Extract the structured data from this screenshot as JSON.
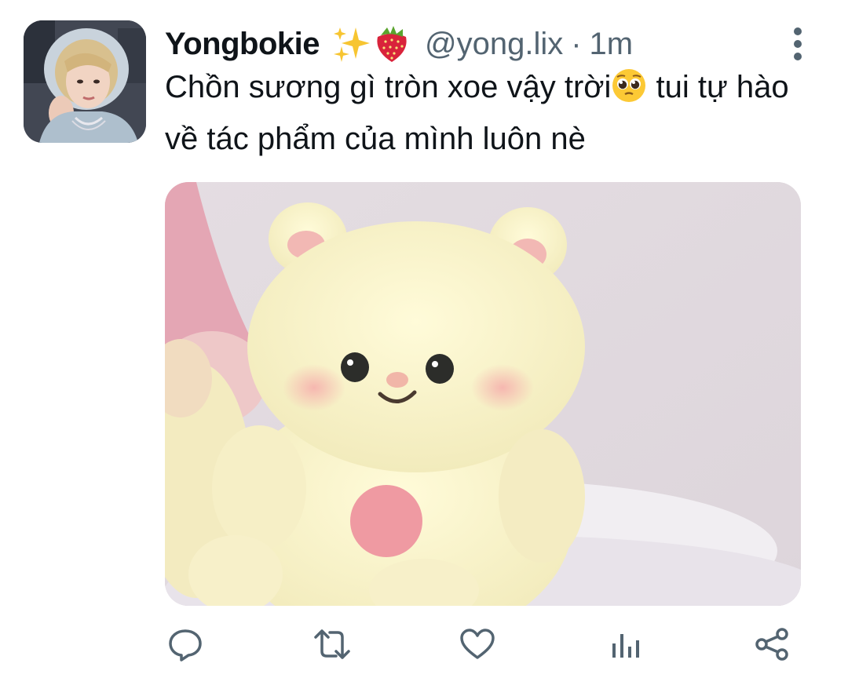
{
  "tweet": {
    "display_name": "Yongbokie",
    "handle": "@yong.lix",
    "separator": "·",
    "time": "1m",
    "text_part1": "Chồn sương gì tròn xoe vậy trời",
    "text_part2": " tui tự hào về tác phẩm của mình luôn nè"
  },
  "icons": {
    "name_badges": [
      "sparkles-emoji",
      "strawberry-emoji"
    ],
    "text_emoji": "pleading-face-emoji",
    "more": "more-vertical-icon",
    "actions": [
      "reply-icon",
      "retweet-icon",
      "like-icon",
      "analytics-icon",
      "share-icon"
    ]
  },
  "colors": {
    "primary_text": "#0f1419",
    "secondary_text": "#536471",
    "icon": "#536471"
  }
}
